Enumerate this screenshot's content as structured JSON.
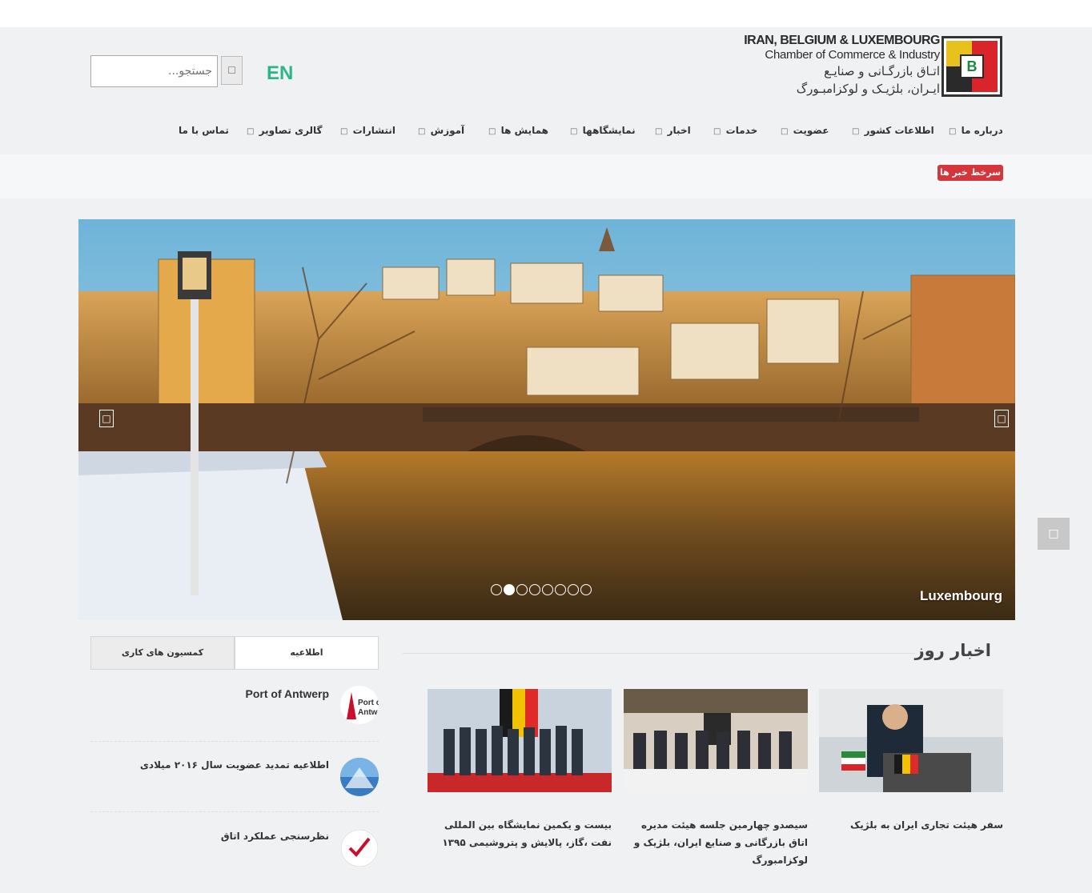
{
  "logo": {
    "en_line1": "IRAN, BELGIUM & LUXEMBOURG",
    "en_line2": "Chamber of Commerce & Industry",
    "fa_line1": "اتـاق بازرگـانی و صنایـع",
    "fa_line2": "ایـران، بلژیـک و لوکزامبـورگ",
    "mark_letter": "B"
  },
  "header": {
    "lang_switch": "EN",
    "search_placeholder": "جستجو...",
    "search_icon": "search-icon"
  },
  "nav": {
    "items": [
      {
        "label": "درباره ما"
      },
      {
        "label": "اطلاعات کشور"
      },
      {
        "label": "عضویت"
      },
      {
        "label": "خدمات"
      },
      {
        "label": "اخبار"
      },
      {
        "label": "نمایشگاهها"
      },
      {
        "label": "همایش ها"
      },
      {
        "label": "آموزش"
      },
      {
        "label": "انتشارات"
      },
      {
        "label": "گالری تصاویر"
      },
      {
        "label": "تماس با ما"
      }
    ]
  },
  "ticker": {
    "badge": "سرخط خبر ها :"
  },
  "slider": {
    "caption": "Luxembourg",
    "slide_count": 8,
    "active_index": 1,
    "prev_icon": "chevron-left-icon",
    "next_icon": "chevron-right-icon"
  },
  "news": {
    "title": "اخبار روز",
    "cards": [
      {
        "caption": "سفر هیئت تجاری ایران به بلژیک"
      },
      {
        "caption": "سیصدو چهارمین جلسه هیئت مدیره اتاق بازرگانی و صنایع ایران، بلژیک و لوکزامبورگ"
      },
      {
        "caption": "بیست و یکمین نمایشگاه بین المللی نفت ،گاز، پالایش و پتروشیمی ۱۳۹۵"
      }
    ]
  },
  "sidebar": {
    "tabs": [
      {
        "label": "اطلاعیه"
      },
      {
        "label": "کمسیون های کاری"
      }
    ],
    "items": [
      {
        "label": "Port of Antwerp",
        "thumb_text": "Port of Antwerp"
      },
      {
        "label": "اطلاعیه تمدید عضویت سال ۲۰۱۶ میلادی"
      },
      {
        "label": "نظرسنجی عملکرد اتاق"
      }
    ]
  },
  "colors": {
    "accent_green": "#2cb587",
    "ticker_red": "#d6353a",
    "background": "#f0f1f3"
  }
}
